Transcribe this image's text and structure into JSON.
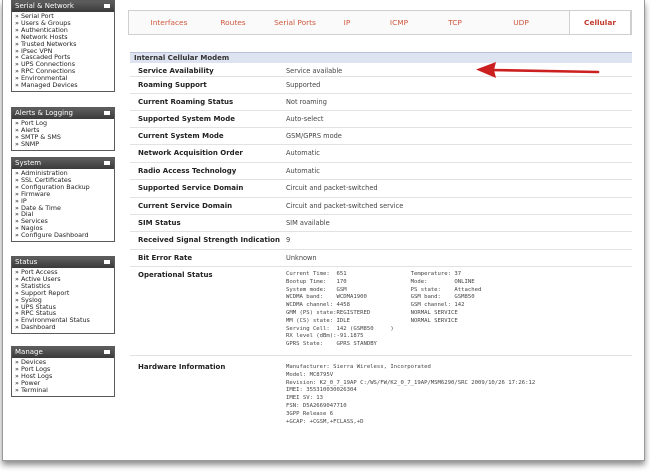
{
  "sidebar": {
    "serial_network": {
      "title": "Serial & Network",
      "items": [
        "» Serial Port",
        "» Users & Groups",
        "» Authentication",
        "» Network Hosts",
        "» Trusted Networks",
        "» IPsec VPN",
        "» Cascaded Ports",
        "» UPS Connections",
        "» RPC Connections",
        "» Environmental",
        "» Managed Devices"
      ]
    },
    "alerts_logging": {
      "title": "Alerts & Logging",
      "items": [
        "» Port Log",
        "» Alerts",
        "» SMTP & SMS",
        "» SNMP"
      ]
    },
    "system": {
      "title": "System",
      "items": [
        "» Administration",
        "» SSL Certificates",
        "» Configuration Backup",
        "» Firmware",
        "» IP",
        "» Date & Time",
        "» Dial",
        "» Services",
        "» Nagios",
        "» Configure Dashboard"
      ]
    },
    "status": {
      "title": "Status",
      "items": [
        "» Port Access",
        "» Active Users",
        "» Statistics",
        "» Support Report",
        "» Syslog",
        "» UPS Status",
        "» RPC Status",
        "» Environmental Status",
        "» Dashboard"
      ]
    },
    "manage": {
      "title": "Manage",
      "items": [
        "» Devices",
        "» Port Logs",
        "» Host Logs",
        "» Power",
        "» Terminal"
      ]
    }
  },
  "tabs": [
    "Interfaces",
    "Routes",
    "Serial Ports",
    "IP",
    "ICMP",
    "TCP",
    "UDP",
    "Cellular"
  ],
  "active_tab": "Cellular",
  "section_title": "Internal Cellular Modem",
  "rows": [
    {
      "label": "Service Availability",
      "value": "Service available"
    },
    {
      "label": "Roaming Support",
      "value": "Supported"
    },
    {
      "label": "Current Roaming Status",
      "value": "Not roaming"
    },
    {
      "label": "Supported System Mode",
      "value": "Auto-select"
    },
    {
      "label": "Current System Mode",
      "value": "GSM/GPRS mode"
    },
    {
      "label": "Network Acquisition Order",
      "value": "Automatic"
    },
    {
      "label": "Radio Access Technology",
      "value": "Automatic"
    },
    {
      "label": "Supported Service Domain",
      "value": "Circuit and packet-switched"
    },
    {
      "label": "Current Service Domain",
      "value": "Circuit and packet-switched service"
    },
    {
      "label": "SIM Status",
      "value": "SIM available"
    },
    {
      "label": "Received Signal Strength Indication",
      "value": "9"
    },
    {
      "label": "Bit Error Rate",
      "value": "Unknown"
    }
  ],
  "operational": {
    "label": "Operational Status",
    "text": "Current Time:  651                   Temperature: 37\nBootup Time:   170                   Mode:        ONLINE\nSystem mode:   GSM                   PS state:    Attached\nWCDMA band:    WCDMA1900             GSM band:    GSM850\nWCDMA channel: 4458                  GSM channel: 142\nGMM (PS) state:REGISTERED            NORMAL SERVICE\nMM (CS) state: IDLE                  NORMAL SERVICE\nServing Cell:  142 (GSM850     )\nRX level (dBm):-91.1875\nGPRS State:    GPRS STANDBY"
  },
  "hardware": {
    "label": "Hardware Information",
    "text": "Manufacturer: Sierra Wireless, Incorporated\nModel: MC8795V\nRevision: K2_0_7_19AP C:/WS/FW/K2_0_7_19AP/MSM6290/SRC 2009/10/26 17:26:12\nIMEI: 355310030026304\nIMEI SV: 13\nFSN: D5A2669047710\n3GPP Release 6\n+GCAP: +CGSM,+FCLASS,+D"
  },
  "colors": {
    "tab_text": "#d0583f",
    "section_header_bg": "#dde3f0",
    "sidebar_header_bg": "#444444",
    "arrow": "#cc1f1f"
  }
}
